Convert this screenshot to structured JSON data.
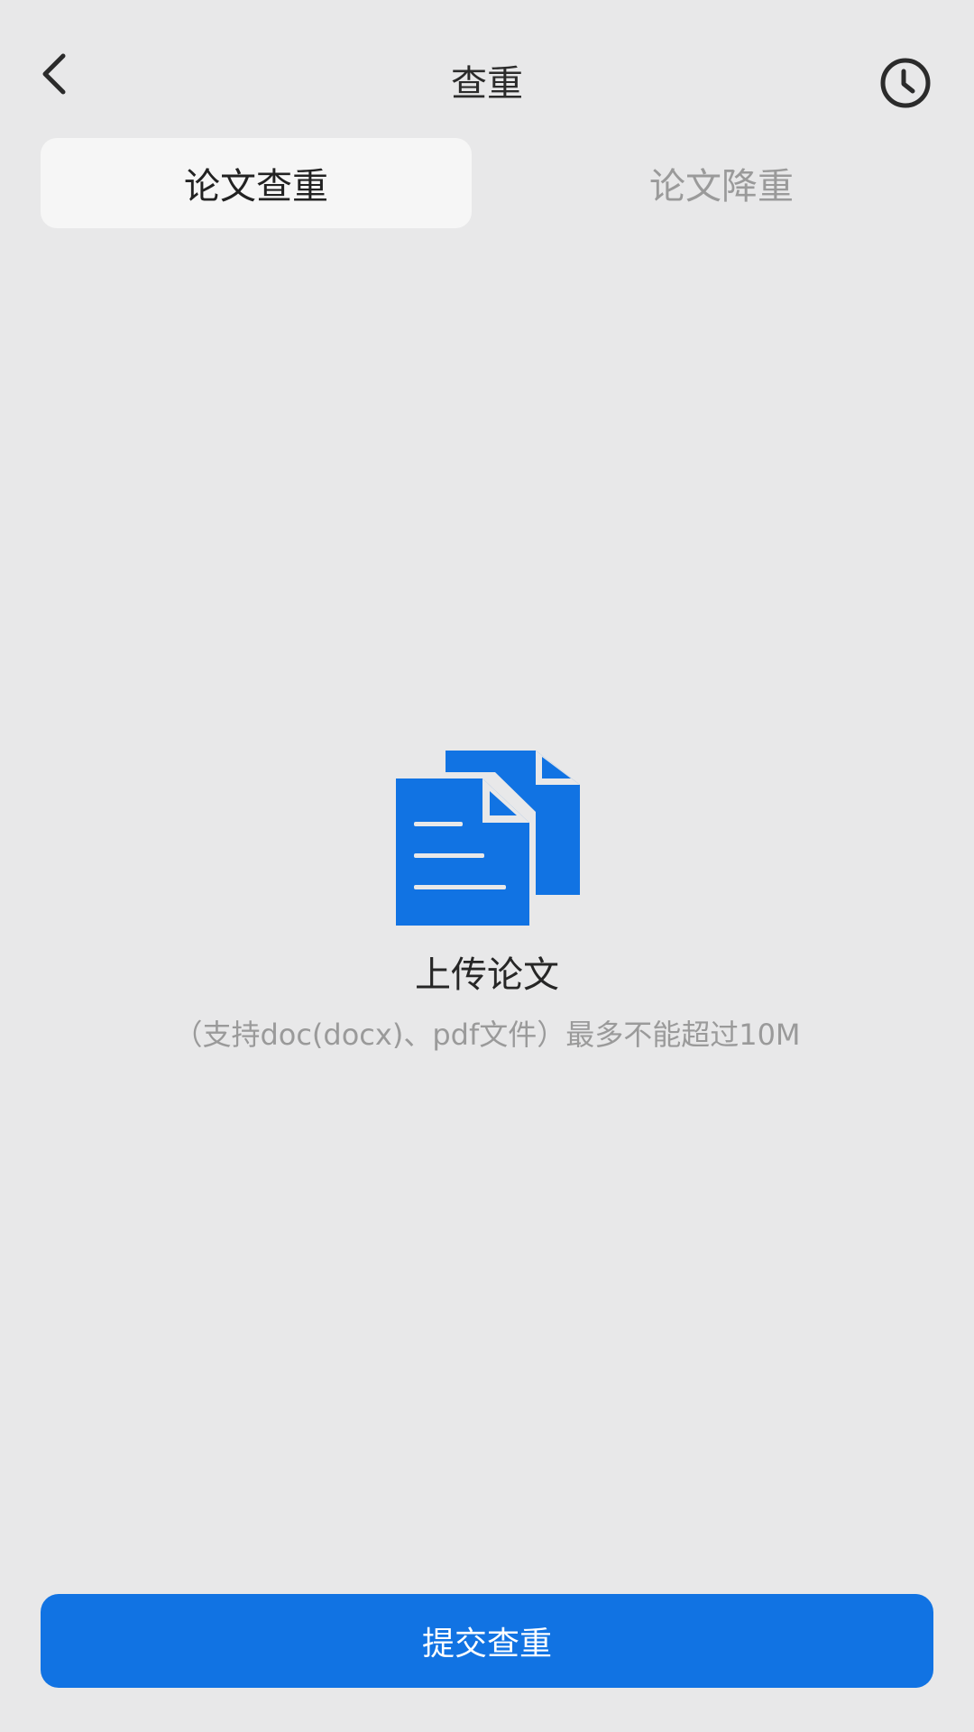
{
  "header": {
    "title": "查重",
    "back_icon": "chevron-left-icon",
    "history_icon": "clock-icon"
  },
  "tabs": [
    {
      "label": "论文查重",
      "active": true
    },
    {
      "label": "论文降重",
      "active": false
    }
  ],
  "upload": {
    "icon": "documents-icon",
    "label": "上传论文",
    "hint": "（支持doc(docx)、pdf文件）最多不能超过10M"
  },
  "submit": {
    "label": "提交查重"
  },
  "colors": {
    "background": "#e8e8e9",
    "accent": "#1173e3",
    "tab_active_bg": "#f6f6f6",
    "muted_text": "#9a9a9a"
  }
}
